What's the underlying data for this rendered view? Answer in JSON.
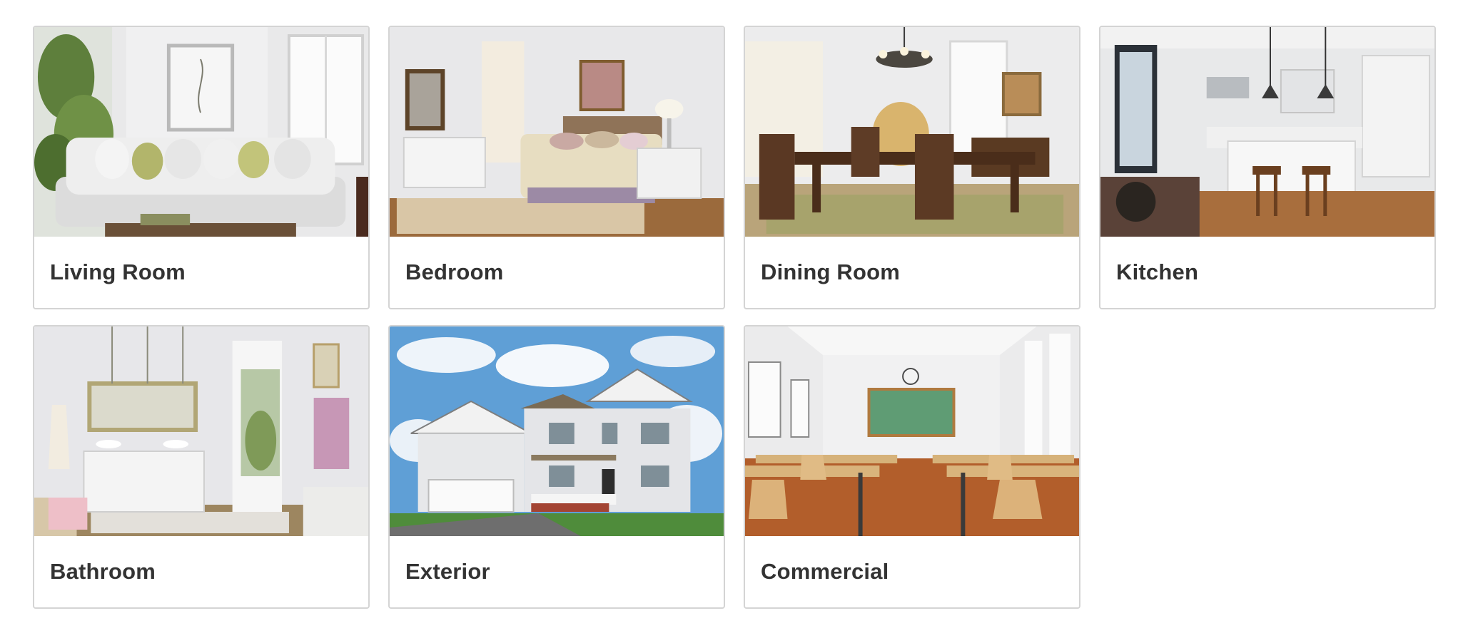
{
  "categories": [
    {
      "label": "Living Room",
      "image": "living-room-photo"
    },
    {
      "label": "Bedroom",
      "image": "bedroom-photo"
    },
    {
      "label": "Dining Room",
      "image": "dining-room-photo"
    },
    {
      "label": "Kitchen",
      "image": "kitchen-photo"
    },
    {
      "label": "Bathroom",
      "image": "bathroom-photo"
    },
    {
      "label": "Exterior",
      "image": "exterior-photo"
    },
    {
      "label": "Commercial",
      "image": "commercial-photo"
    }
  ]
}
